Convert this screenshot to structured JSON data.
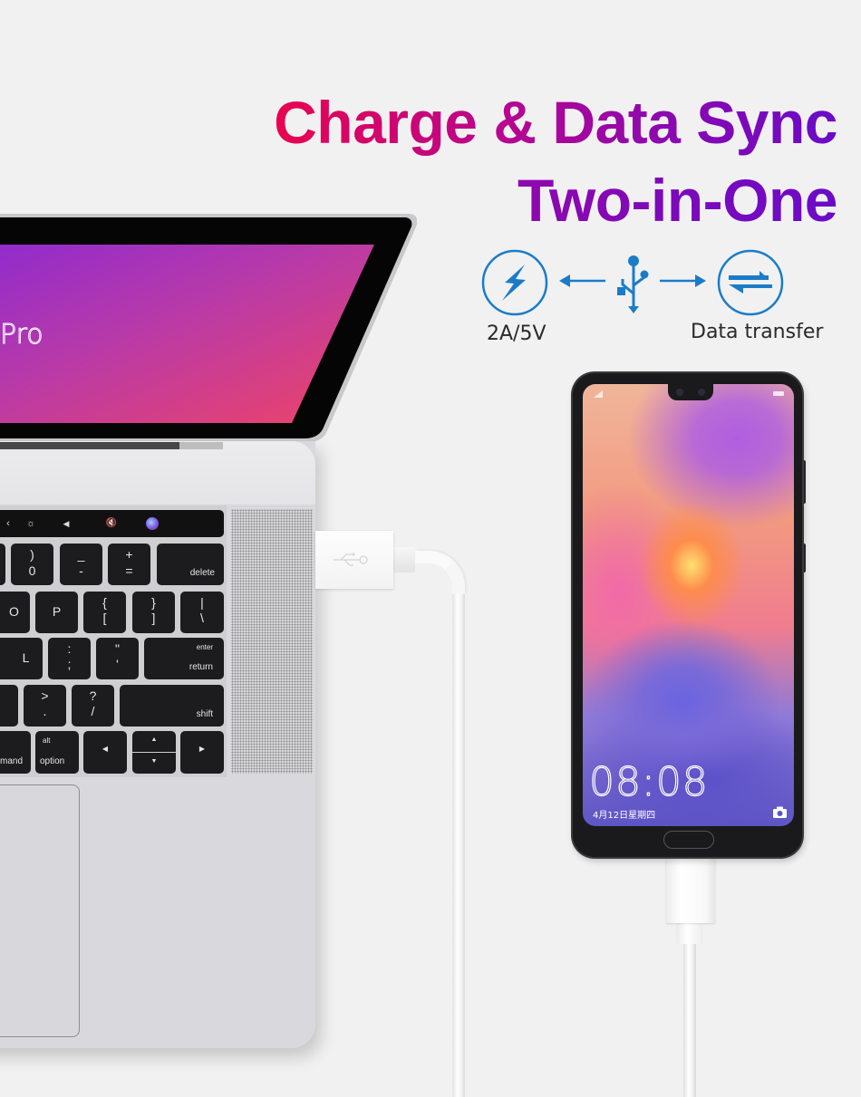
{
  "headline": {
    "line1": "Charge & Data Sync",
    "line2": "Two-in-One",
    "gradient_start": "#e8044f",
    "gradient_end": "#6a0bc8"
  },
  "features": {
    "accent_color": "#1a7cc9",
    "charge": {
      "icon": "lightning-bolt-icon",
      "label": "2A/5V"
    },
    "center": {
      "icon": "usb-icon"
    },
    "data": {
      "icon": "transfer-arrows-icon",
      "label": "Data transfer"
    }
  },
  "laptop": {
    "screen_text": "Pro",
    "touchbar": [
      "‹",
      "☼",
      "◀",
      "🔇",
      "siri"
    ],
    "keys": {
      "row1": [
        {
          "top": ")",
          "bottom": "0"
        },
        {
          "top": "_",
          "bottom": "-"
        },
        {
          "top": "+",
          "bottom": "="
        },
        {
          "label": "delete"
        }
      ],
      "row2": [
        {
          "label": "O"
        },
        {
          "label": "P"
        },
        {
          "top": "{",
          "bottom": "["
        },
        {
          "top": "}",
          "bottom": "]"
        },
        {
          "top": "|",
          "bottom": "\\"
        }
      ],
      "row3": [
        {
          "label": "L"
        },
        {
          "top": ":",
          "bottom": ";"
        },
        {
          "top": "\"",
          "bottom": "'"
        },
        {
          "top": "enter",
          "bottom": "return"
        }
      ],
      "row4": [
        {
          "top": ">",
          "bottom": "."
        },
        {
          "top": "?",
          "bottom": "/"
        },
        {
          "label": "shift"
        }
      ],
      "row5": [
        {
          "label": "mand"
        },
        {
          "top": "alt",
          "bottom": "option"
        },
        {
          "label": "◀"
        },
        {
          "top": "▲",
          "bottom": "▼"
        },
        {
          "label": "▶"
        }
      ]
    }
  },
  "phone": {
    "time": "08:08",
    "date": "4月12日星期四"
  }
}
